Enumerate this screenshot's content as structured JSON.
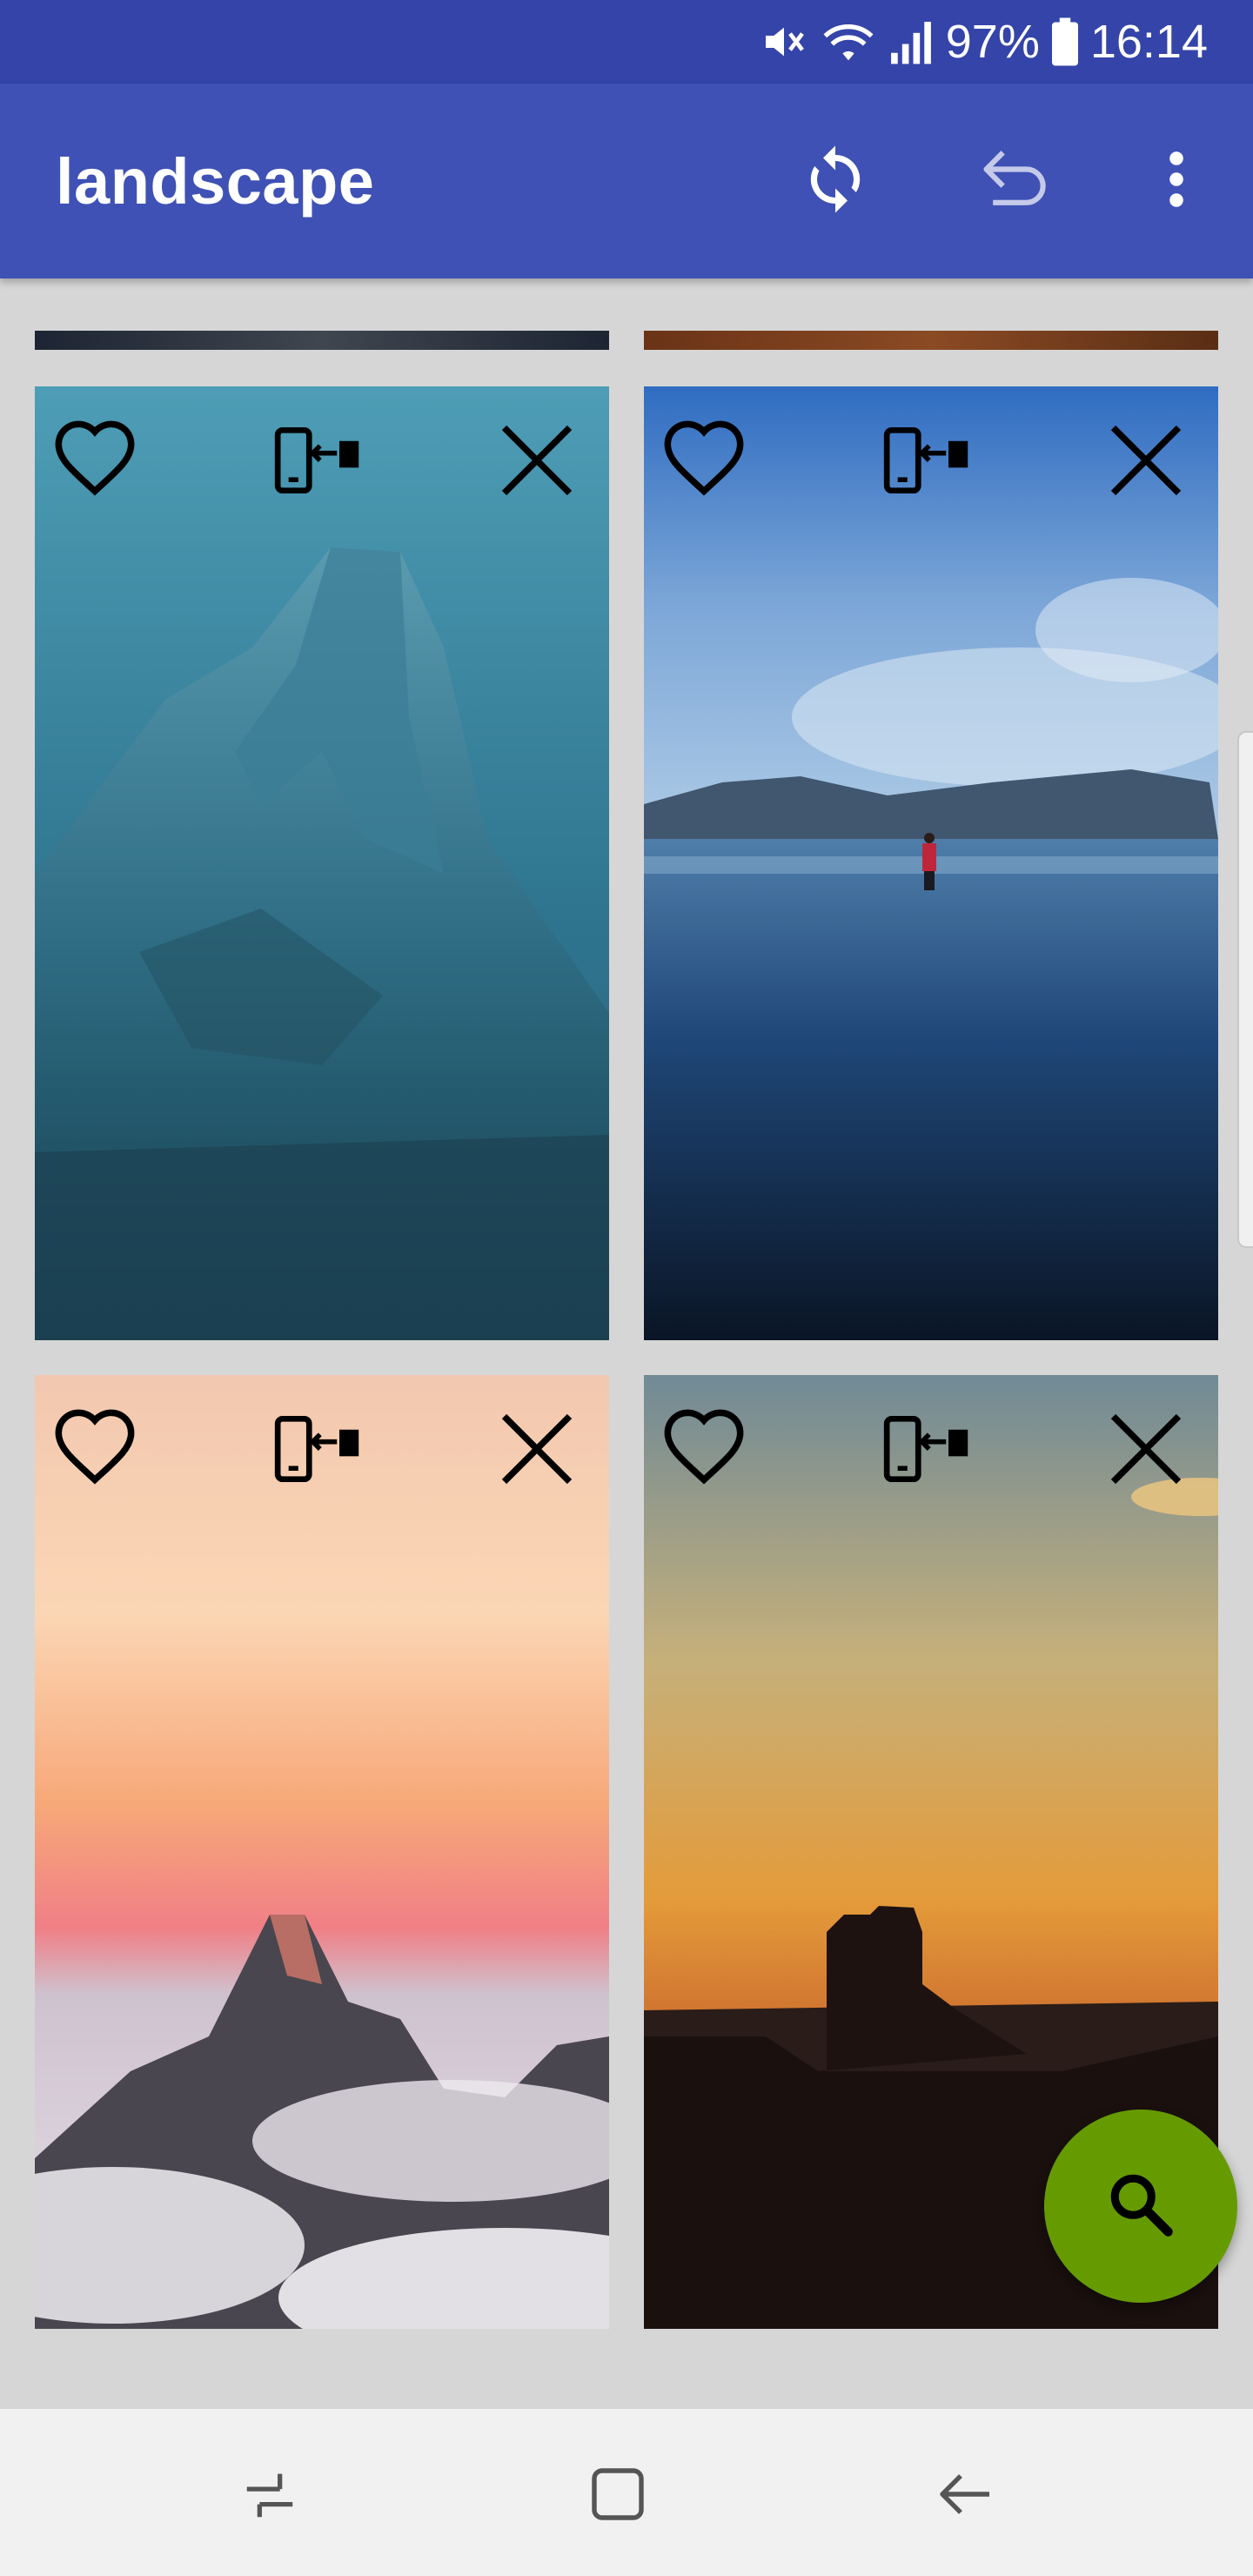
{
  "status_bar": {
    "battery_percent": "97%",
    "time": "16:14",
    "icons": [
      "mute-icon",
      "wifi-icon",
      "signal-icon",
      "battery-icon"
    ]
  },
  "app_bar": {
    "title": "landscape",
    "actions": [
      "refresh-icon",
      "undo-icon",
      "more-vert-icon"
    ]
  },
  "wallpapers": [
    {
      "name": "blue mountain peak in fog",
      "favorite": false
    },
    {
      "name": "person walking on reflective beach",
      "favorite": false
    },
    {
      "name": "mountain peak above clouds at sunset",
      "favorite": false
    },
    {
      "name": "desert butte at sunset",
      "favorite": false
    }
  ],
  "card_actions": [
    "favorite-icon",
    "set-wallpaper-icon",
    "remove-icon"
  ],
  "fab": {
    "icon": "search-icon",
    "color": "#669b00"
  },
  "nav_bar": {
    "buttons": [
      "recents-icon",
      "home-icon",
      "back-icon"
    ]
  },
  "colors": {
    "status_bar": "#3444a8",
    "app_bar": "#3f51b5",
    "background": "#d6d6d6"
  }
}
